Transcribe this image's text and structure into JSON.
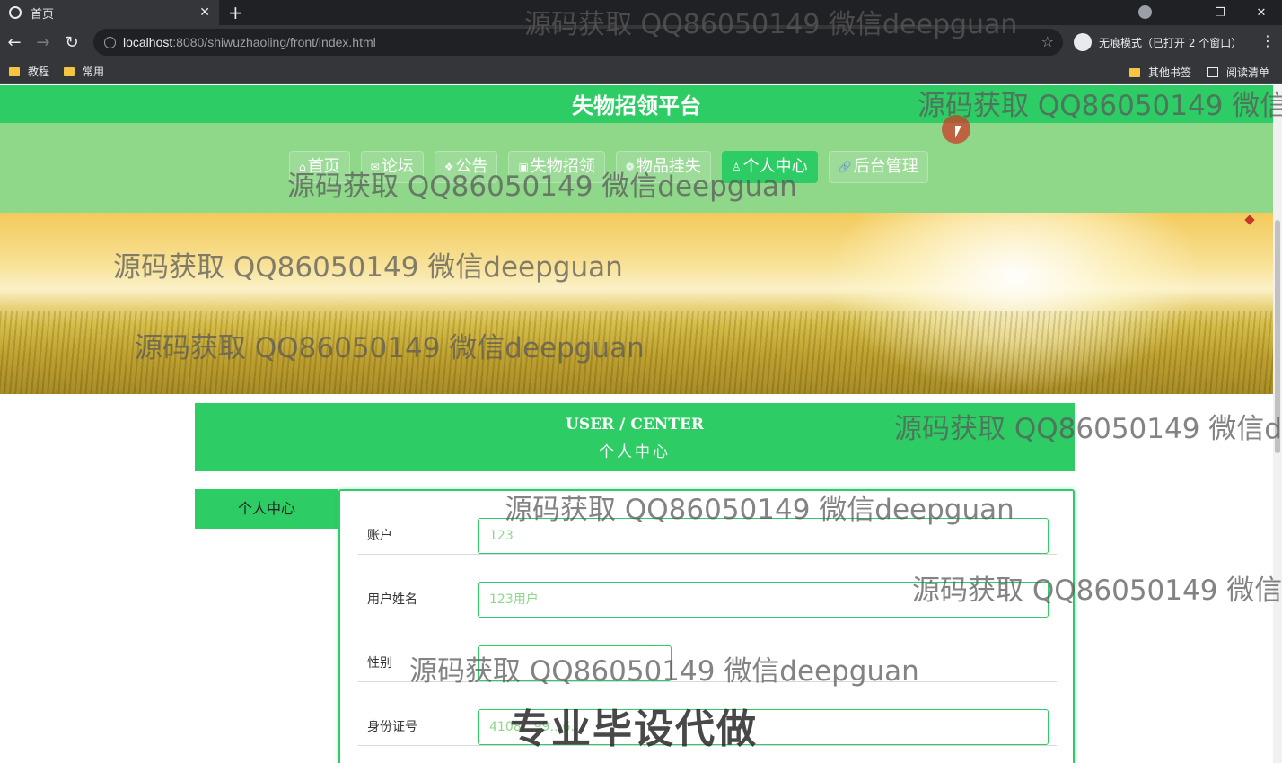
{
  "browser": {
    "tab_title": "首页",
    "tab_close": "✕",
    "new_tab": "+",
    "url_host": "localhost",
    "url_rest": ":8080/shiwuzhaoling/front/index.html",
    "incognito_label": "无痕模式（已打开 2 个窗口）",
    "bookmarks": [
      "教程",
      "常用"
    ],
    "bookmarks_right": [
      "其他书签",
      "阅读清单"
    ],
    "win_minimize": "—",
    "win_restore": "❐",
    "win_close": "✕"
  },
  "site": {
    "title": "失物招领平台",
    "nav": [
      {
        "icon": "⌂",
        "label": "首页"
      },
      {
        "icon": "✉",
        "label": "论坛"
      },
      {
        "icon": "❖",
        "label": "公告"
      },
      {
        "icon": "▣",
        "label": "失物招领"
      },
      {
        "icon": "❁",
        "label": "物品挂失"
      },
      {
        "icon": "♙",
        "label": "个人中心",
        "active": true
      },
      {
        "icon": "🔗",
        "label": "后台管理"
      }
    ]
  },
  "user_center": {
    "en": "USER / CENTER",
    "zh": "个人中心",
    "side_menu": "个人中心"
  },
  "form": {
    "fields": [
      {
        "label": "账户",
        "value": "123"
      },
      {
        "label": "用户姓名",
        "value": "123用户"
      },
      {
        "label": "性别",
        "value": ""
      },
      {
        "label": "身份证号",
        "value": "4108…99…6…"
      }
    ]
  },
  "watermarks": {
    "text": "源码获取 QQ86050149 微信deepguan",
    "cut1": "源码获取 QQ86050149 微信d",
    "cut2": "源码获取 QQ86050149 微信de",
    "cut3": "源码获取 QQ86050149 微信de",
    "big": "专业毕设代做"
  },
  "colors": {
    "brand_green": "#2ecc64",
    "nav_bg": "#8fd88a"
  }
}
